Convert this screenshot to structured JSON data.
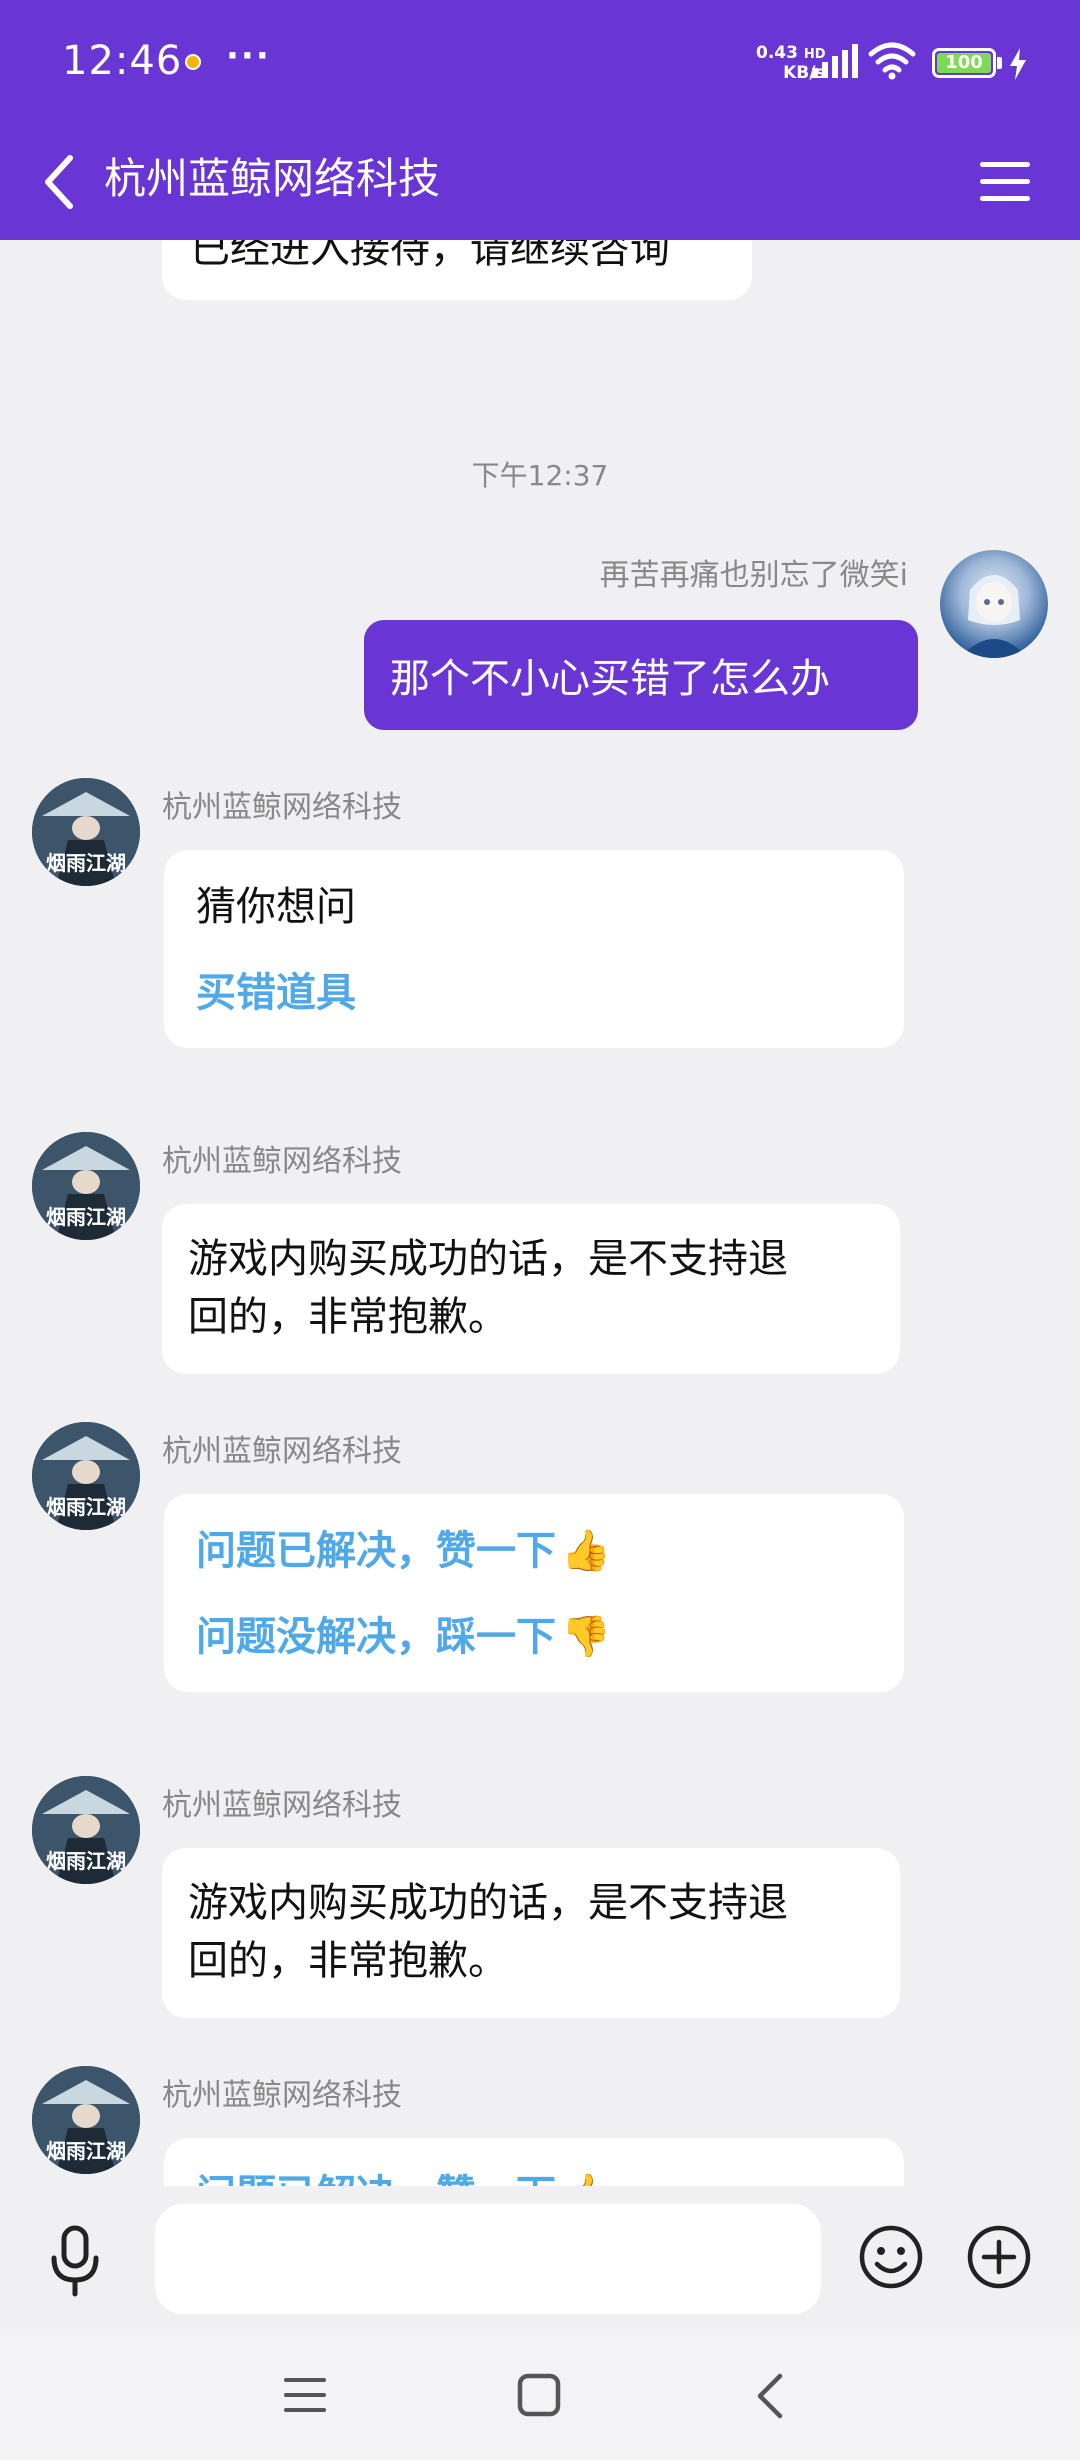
{
  "status_bar": {
    "time": "12:46",
    "more": "···",
    "speed_value": "0.43",
    "speed_hd": "HD",
    "speed_unit": "KB/s",
    "battery": "100"
  },
  "header": {
    "title": "杭州蓝鲸网络科技"
  },
  "chat": {
    "partial_message": "已经进入接待，请继续咨询",
    "timestamp": "下午12:37",
    "user_name": "再苦再痛也别忘了微笑i",
    "user_message": "那个不小心买错了怎么办",
    "agent_name": "杭州蓝鲸网络科技",
    "guess_title": "猜你想问",
    "guess_link": "买错道具",
    "reply_line1": "游戏内购买成功的话，是不支持退",
    "reply_line2": "回的，非常抱歉。",
    "feedback_good": "问题已解决，赞一下",
    "feedback_bad": "问题没解决，踩一下",
    "thumb_up": "👍",
    "thumb_down": "👎",
    "avatar_text": "烟雨江湖"
  },
  "input": {
    "value": "",
    "placeholder": ""
  },
  "colors": {
    "header_bg": "#6a35d5",
    "user_bubble": "#6a35d5",
    "link": "#4fa8e8",
    "chat_bg": "#f0f0f3"
  }
}
